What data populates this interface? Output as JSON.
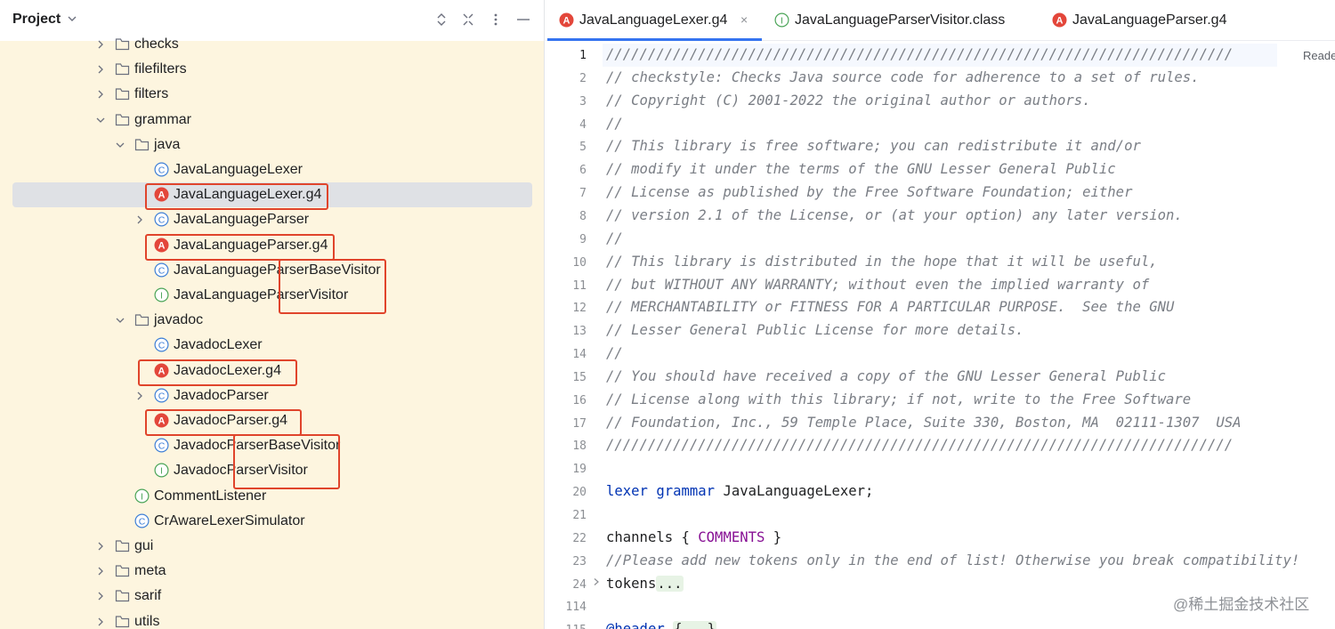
{
  "project_panel": {
    "title": "Project",
    "tree": [
      {
        "label": "checks",
        "kind": "folder",
        "expanded": false
      },
      {
        "label": "filefilters",
        "kind": "folder",
        "expanded": false
      },
      {
        "label": "filters",
        "kind": "folder",
        "expanded": false
      },
      {
        "label": "grammar",
        "kind": "folder",
        "expanded": true
      },
      {
        "label": "java",
        "kind": "folder",
        "expanded": true
      },
      {
        "label": "JavaLanguageLexer",
        "kind": "class"
      },
      {
        "label": "JavaLanguageLexer.g4",
        "kind": "antlr",
        "selected": true
      },
      {
        "label": "JavaLanguageParser",
        "kind": "class",
        "expandable": true
      },
      {
        "label": "JavaLanguageParser.g4",
        "kind": "antlr"
      },
      {
        "label": "JavaLanguageParserBaseVisitor",
        "kind": "class"
      },
      {
        "label": "JavaLanguageParserVisitor",
        "kind": "interface"
      },
      {
        "label": "javadoc",
        "kind": "folder",
        "expanded": true
      },
      {
        "label": "JavadocLexer",
        "kind": "class"
      },
      {
        "label": "JavadocLexer.g4",
        "kind": "antlr"
      },
      {
        "label": "JavadocParser",
        "kind": "class",
        "expandable": true
      },
      {
        "label": "JavadocParser.g4",
        "kind": "antlr"
      },
      {
        "label": "JavadocParserBaseVisitor",
        "kind": "class"
      },
      {
        "label": "JavadocParserVisitor",
        "kind": "interface"
      },
      {
        "label": "CommentListener",
        "kind": "interface"
      },
      {
        "label": "CrAwareLexerSimulator",
        "kind": "class"
      },
      {
        "label": "gui",
        "kind": "folder",
        "expanded": false
      },
      {
        "label": "meta",
        "kind": "folder",
        "expanded": false
      },
      {
        "label": "sarif",
        "kind": "folder",
        "expanded": false
      },
      {
        "label": "utils",
        "kind": "folder",
        "expanded": false
      }
    ],
    "icon_letters": {
      "class": "C",
      "interface": "I",
      "antlr": "A"
    }
  },
  "editor": {
    "tabs": [
      {
        "label": "JavaLanguageLexer.g4",
        "icon": "antlr-icon",
        "active": true,
        "close": "×"
      },
      {
        "label": "JavaLanguageParserVisitor.class",
        "icon": "interface-icon",
        "active": false
      },
      {
        "label": "JavaLanguageParser.g4",
        "icon": "antlr-icon",
        "active": false
      }
    ],
    "reader_mode_label": "Reade",
    "line_numbers": [
      "1",
      "2",
      "3",
      "4",
      "5",
      "6",
      "7",
      "8",
      "9",
      "10",
      "11",
      "12",
      "13",
      "14",
      "15",
      "16",
      "17",
      "18",
      "19",
      "20",
      "21",
      "22",
      "23",
      "24",
      "114",
      "115"
    ],
    "comment_lines": [
      "///////////////////////////////////////////////////////////////////////////",
      "// checkstyle: Checks Java source code for adherence to a set of rules.",
      "// Copyright (C) 2001-2022 the original author or authors.",
      "//",
      "// This library is free software; you can redistribute it and/or",
      "// modify it under the terms of the GNU Lesser General Public",
      "// License as published by the Free Software Foundation; either",
      "// version 2.1 of the License, or (at your option) any later version.",
      "//",
      "// This library is distributed in the hope that it will be useful,",
      "// but WITHOUT ANY WARRANTY; without even the implied warranty of",
      "// MERCHANTABILITY or FITNESS FOR A PARTICULAR PURPOSE.  See the GNU",
      "// Lesser General Public License for more details.",
      "//",
      "// You should have received a copy of the GNU Lesser General Public",
      "// License along with this library; if not, write to the Free Software",
      "// Foundation, Inc., 59 Temple Place, Suite 330, Boston, MA  02111-1307  USA",
      "///////////////////////////////////////////////////////////////////////////"
    ],
    "line20": {
      "kw1": "lexer",
      "kw2": "grammar",
      "name": " JavaLanguageLexer;"
    },
    "line22": {
      "pre": "channels { ",
      "token": "COMMENTS",
      "post": " }"
    },
    "line23": "//Please add new tokens only in the end of list! Otherwise you break compatibility!",
    "line24": {
      "word": "tokens",
      "fold": "..."
    },
    "line115": {
      "word": "@header",
      "fold": "{...}"
    }
  },
  "watermark": "@稀土掘金技术社区",
  "colors": {
    "tree_bg": "#fdf5df",
    "selection": "#dfe1e5",
    "highlight_box": "#e0442b",
    "active_tab": "#3574f0"
  }
}
